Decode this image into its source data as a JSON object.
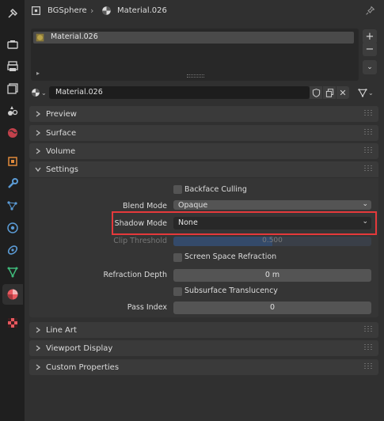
{
  "header": {
    "object_name": "BGSphere",
    "material_name": "Material.026"
  },
  "material_slots": {
    "items": [
      "Material.026"
    ]
  },
  "material_selector": {
    "value": "Material.026"
  },
  "panels": {
    "preview": "Preview",
    "surface": "Surface",
    "volume": "Volume",
    "settings": "Settings",
    "line_art": "Line Art",
    "viewport_display": "Viewport Display",
    "custom_properties": "Custom Properties"
  },
  "settings": {
    "backface_culling": {
      "label": "Backface Culling",
      "checked": false
    },
    "blend_mode": {
      "label": "Blend Mode",
      "value": "Opaque"
    },
    "shadow_mode": {
      "label": "Shadow Mode",
      "value": "None"
    },
    "clip_threshold": {
      "label": "Clip Threshold",
      "value": "0.500"
    },
    "screen_space_refraction": {
      "label": "Screen Space Refraction",
      "checked": false
    },
    "refraction_depth": {
      "label": "Refraction Depth",
      "value": "0 m"
    },
    "subsurface_translucency": {
      "label": "Subsurface Translucency",
      "checked": false
    },
    "pass_index": {
      "label": "Pass Index",
      "value": "0"
    }
  },
  "colors": {
    "highlight_box": "#e5393b",
    "accent_blue": "#4772b3",
    "active_tab_icon": "#e8585e"
  }
}
